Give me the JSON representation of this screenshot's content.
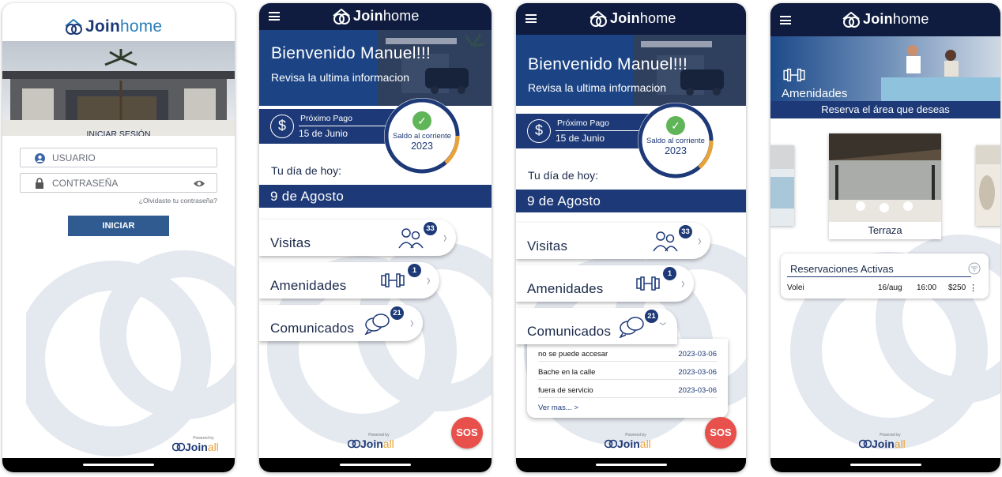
{
  "brand": {
    "logo_bold": "Join",
    "logo_light": "home",
    "powered_by": "Powered by",
    "footer_bold": "Join",
    "footer_light": "all"
  },
  "colors": {
    "navy": "#0f1c3f",
    "blue": "#1d3977",
    "accent_green": "#5fb558",
    "accent_orange": "#e8a23a",
    "sos_red": "#e8504b",
    "button_blue": "#2f5b91"
  },
  "login": {
    "title": "INICIAR SESIÓN",
    "username_placeholder": "USUARIO",
    "password_placeholder": "CONTRASEÑA",
    "forgot": "¿Olvidaste tu contraseña?",
    "submit": "INICIAR",
    "icons": [
      "user-icon",
      "lock-icon",
      "eye-icon"
    ]
  },
  "home": {
    "welcome": "Bienvenido Manuel!!!",
    "subtitle": "Revisa la ultima informacion",
    "next_payment_label": "Próximo Pago",
    "next_payment_date": "15 de Junio",
    "status_text": "Saldo al corriente",
    "status_year": "2023",
    "day_label": "Tu día de hoy:",
    "date": "9 de Agosto",
    "cards": [
      {
        "label": "Visitas",
        "count": "33",
        "icon": "visitors-icon"
      },
      {
        "label": "Amenidades",
        "count": "1",
        "icon": "dumbbell-icon"
      },
      {
        "label": "Comunicados",
        "count": "21",
        "icon": "chat-bubbles-icon"
      }
    ],
    "sos": "SOS"
  },
  "comunicados": {
    "items": [
      {
        "title": "no se puede accesar",
        "date": "2023-03-06"
      },
      {
        "title": "Bache en la calle",
        "date": "2023-03-06"
      },
      {
        "title": "fuera de servicio",
        "date": "2023-03-06"
      }
    ],
    "more": "Ver mas... >"
  },
  "amenidades": {
    "title": "Amenidades",
    "subtitle": "Reserva el área que deseas",
    "featured": "Terraza",
    "reservations_title": "Reservaciones Activas",
    "reservation": {
      "name": "Volei",
      "date": "16/aug",
      "time": "16:00",
      "price": "$250",
      "more": "⋮"
    }
  }
}
